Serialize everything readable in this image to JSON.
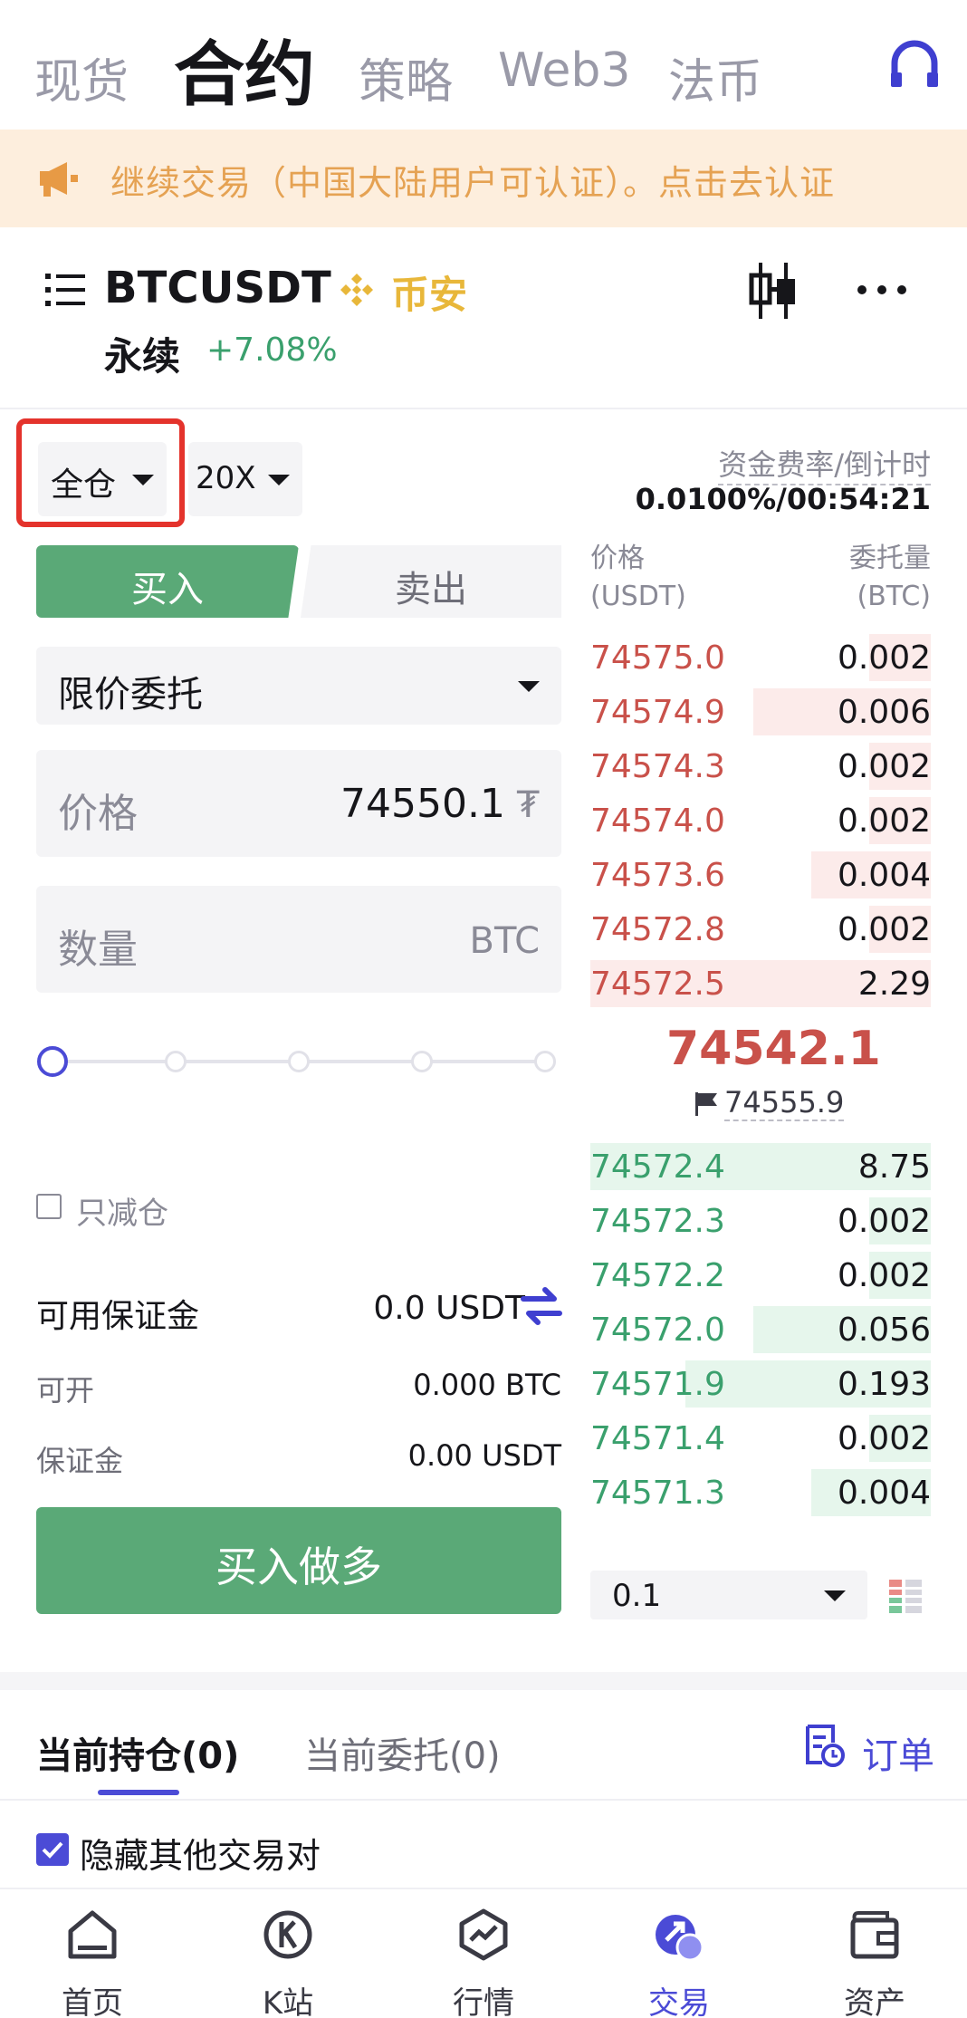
{
  "top_tabs": [
    "现货",
    "合约",
    "策略",
    "Web3",
    "法币"
  ],
  "banner": {
    "text": "继续交易（中国大陆用户可认证）。点击去认证"
  },
  "header": {
    "symbol": "BTCUSDT",
    "exchange": "币安",
    "contract_type": "永续",
    "change": "+7.08%"
  },
  "trade": {
    "margin_mode": "全仓",
    "leverage": "20X",
    "funding_label": "资金费率/倒计时",
    "funding_value": "0.0100%/00:54:21",
    "buy_label": "买入",
    "sell_label": "卖出",
    "order_type": "限价委托",
    "price_label": "价格",
    "price_value": "74550.1",
    "price_unit": "₮",
    "qty_label": "数量",
    "qty_unit": "BTC",
    "reduce_only": "只减仓",
    "available_label": "可用保证金",
    "available_value": "0.0 USDT",
    "can_open_label": "可开",
    "can_open_value": "0.000 BTC",
    "margin_label": "保证金",
    "margin_value": "0.00 USDT",
    "buy_long": "买入做多"
  },
  "orderbook": {
    "price_head": "价格",
    "price_unit": "(USDT)",
    "qty_head": "委托量",
    "qty_unit": "(BTC)",
    "asks": [
      {
        "price": "74575.0",
        "qty": "0.002",
        "depth": 0.18
      },
      {
        "price": "74574.9",
        "qty": "0.006",
        "depth": 0.52
      },
      {
        "price": "74574.3",
        "qty": "0.002",
        "depth": 0.18
      },
      {
        "price": "74574.0",
        "qty": "0.002",
        "depth": 0.18
      },
      {
        "price": "74573.6",
        "qty": "0.004",
        "depth": 0.35
      },
      {
        "price": "74572.8",
        "qty": "0.002",
        "depth": 0.18
      },
      {
        "price": "74572.5",
        "qty": "2.29",
        "depth": 1.0
      }
    ],
    "mid_price": "74542.1",
    "mark_price": "74555.9",
    "bids": [
      {
        "price": "74572.4",
        "qty": "8.75",
        "depth": 1.0
      },
      {
        "price": "74572.3",
        "qty": "0.002",
        "depth": 0.18
      },
      {
        "price": "74572.2",
        "qty": "0.002",
        "depth": 0.18
      },
      {
        "price": "74572.0",
        "qty": "0.056",
        "depth": 0.52
      },
      {
        "price": "74571.9",
        "qty": "0.193",
        "depth": 0.72
      },
      {
        "price": "74571.4",
        "qty": "0.002",
        "depth": 0.18
      },
      {
        "price": "74571.3",
        "qty": "0.004",
        "depth": 0.35
      }
    ],
    "precision": "0.1"
  },
  "positions": {
    "tab_positions": "当前持仓(0)",
    "tab_orders": "当前委托(0)",
    "orders_link": "订单",
    "hide_others": "隐藏其他交易对"
  },
  "nav": [
    {
      "label": "首页",
      "icon": "home-icon"
    },
    {
      "label": "K站",
      "icon": "k-station-icon"
    },
    {
      "label": "行情",
      "icon": "market-icon"
    },
    {
      "label": "交易",
      "icon": "trade-icon"
    },
    {
      "label": "资产",
      "icon": "wallet-icon"
    }
  ],
  "colors": {
    "accent": "#4b4bd6",
    "buy": "#5aa977",
    "sell": "#c9514a",
    "binance": "#e8b73a",
    "highlight": "#e4332c"
  }
}
